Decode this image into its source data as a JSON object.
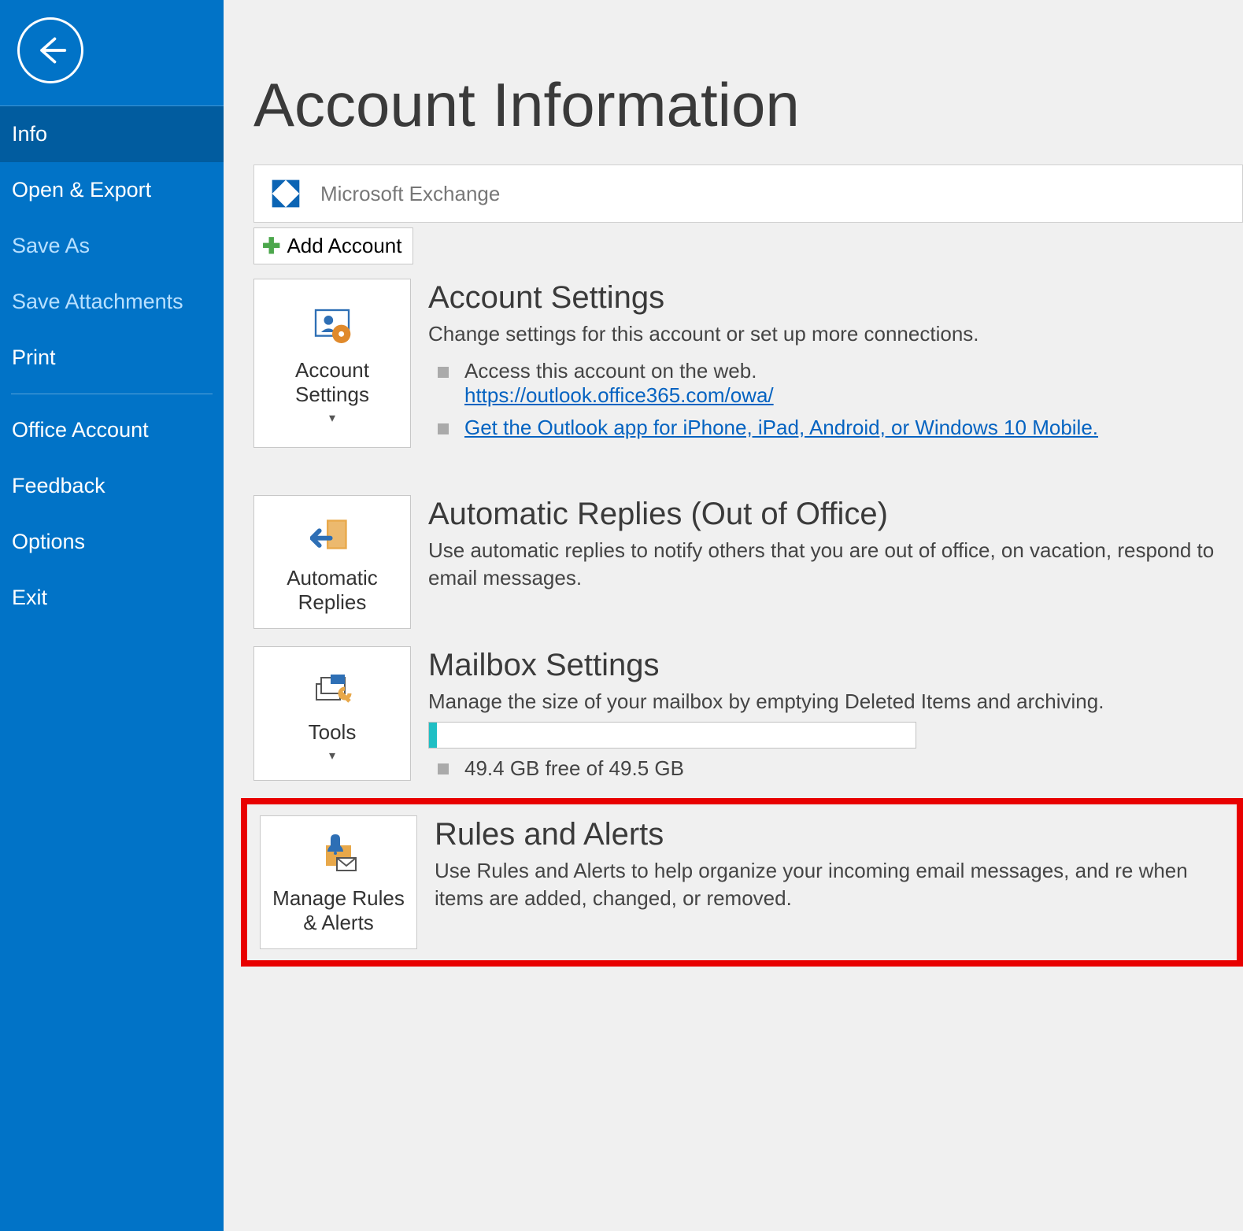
{
  "sidebar": {
    "items": [
      {
        "label": "Info",
        "selected": true
      },
      {
        "label": "Open & Export"
      },
      {
        "label": "Save As",
        "dim": true
      },
      {
        "label": "Save Attachments",
        "dim": true
      },
      {
        "label": "Print"
      },
      {
        "sep": true
      },
      {
        "label": "Office Account"
      },
      {
        "label": "Feedback"
      },
      {
        "label": "Options"
      },
      {
        "label": "Exit"
      }
    ]
  },
  "page": {
    "title": "Account Information"
  },
  "account": {
    "type": "Microsoft Exchange",
    "add_button": "Add Account"
  },
  "accountSettings": {
    "button": "Account Settings",
    "heading": "Account Settings",
    "desc": "Change settings for this account or set up more connections.",
    "bullets": [
      {
        "text": "Access this account on the web.",
        "link": "https://outlook.office365.com/owa/"
      },
      {
        "link": "Get the Outlook app for iPhone, iPad, Android, or Windows 10 Mobile."
      }
    ]
  },
  "autoReplies": {
    "button": "Automatic Replies",
    "heading": "Automatic Replies (Out of Office)",
    "desc": "Use automatic replies to notify others that you are out of office, on vacation, respond to email messages."
  },
  "mailbox": {
    "button": "Tools",
    "heading": "Mailbox Settings",
    "desc": "Manage the size of your mailbox by emptying Deleted Items and archiving.",
    "storage": "49.4 GB free of 49.5 GB"
  },
  "rules": {
    "button": "Manage Rules & Alerts",
    "heading": "Rules and Alerts",
    "desc": "Use Rules and Alerts to help organize your incoming email messages, and re when items are added, changed, or removed."
  }
}
